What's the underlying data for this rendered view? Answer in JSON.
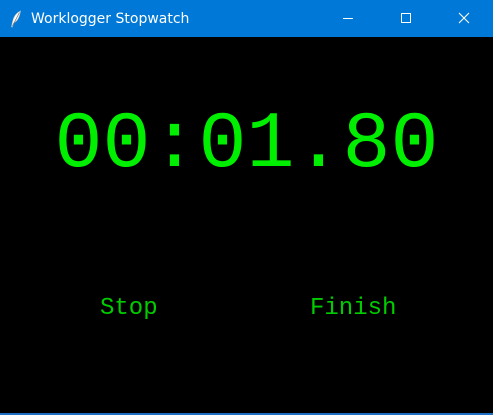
{
  "window": {
    "title": "Worklogger Stopwatch",
    "app_icon": "feather-icon",
    "controls": {
      "minimize_icon": "minimize-icon",
      "maximize_icon": "maximize-icon",
      "close_icon": "close-icon"
    }
  },
  "stopwatch": {
    "display": "00:01.80"
  },
  "buttons": {
    "stop_label": "Stop",
    "finish_label": "Finish"
  },
  "colors": {
    "titlebar": "#0078d7",
    "background": "#000000",
    "display_text": "#00ee00",
    "button_text": "#00cc00"
  }
}
